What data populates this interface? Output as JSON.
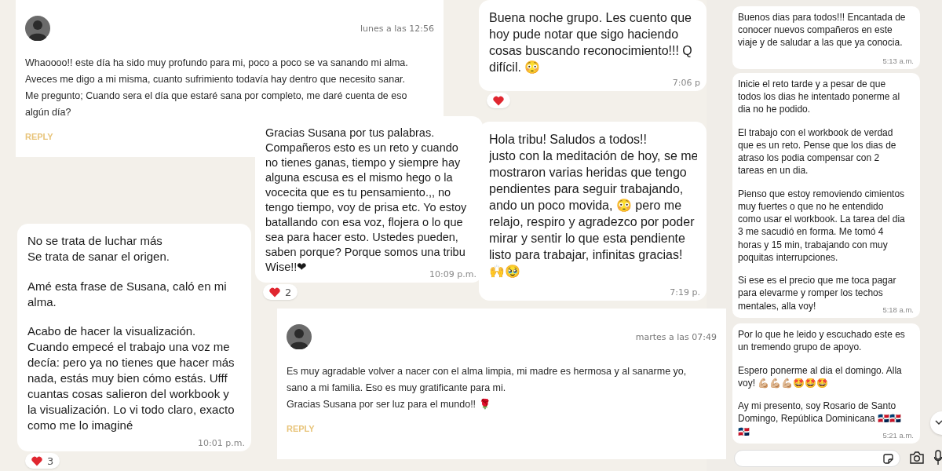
{
  "cards": [
    {
      "kind": "web_comment",
      "time": "lunes a las 12:56",
      "lines": [
        [
          "Whaoooo!! este día ha sido muy profundo para mi, poco a poco se va sanando mi alma.",
          "Aveces me digo a mi misma, cuanto sufrimiento todavía hay dentro que necesito sanar.",
          "Me pregunto; Cuando sera el día que estaré sana por completo, me daré cuenta de eso",
          "algún día?"
        ]
      ],
      "reply": "REPLY"
    },
    {
      "kind": "bubble",
      "lines": [
        [
          "No se trata de luchar más",
          "Se trata de sanar el origen."
        ],
        [
          "Amé esta frase de Susana, caló en mi",
          "alma."
        ],
        [
          "Acabo de hacer la visualización.",
          "Cuando empecé el trabajo una voz me",
          "decía: pero ya no tienes que hacer más",
          "nada, estás muy bien cómo estás. Ufff",
          "cuantas cosas salieron del workbook y",
          "la visualización. Lo vi todo claro, exacto",
          "como me lo imaginé"
        ]
      ],
      "time": "10:01 p.m.",
      "reaction": {
        "count": "3"
      }
    },
    {
      "kind": "bubble",
      "lines": [
        [
          "Gracias Susana por tus palabras.",
          "Compañeros esto es un reto y cuando",
          "no tienes ganas, tiempo y siempre hay",
          "alguna escusa es el mismo hego o la",
          "vocecita que es tu pensamiento.,, no",
          "tengo tiempo, voy de prisa etc. Yo estoy",
          "batallando con esa voz, flojera o lo que",
          "sea  para hacer esto. Ustedes pueden,",
          "saben porque? Porque somos una tribu",
          "Wise!!❤"
        ]
      ],
      "time": "10:09 p.m.",
      "reaction": {
        "count": "2"
      }
    },
    {
      "kind": "bubble",
      "lines": [
        [
          "Buena noche grupo.  Les cuento que",
          "hoy pude notar que sigo haciendo",
          "cosas buscando reconocimiento!!! Q",
          "difícil. 😳"
        ]
      ],
      "time": "7:06 p",
      "reaction": true
    },
    {
      "kind": "bubble",
      "lines": [
        [
          "Hola tribu! Saludos a todos!!",
          "justo con la meditación de hoy, se me",
          "mostraron varias heridas que tengo",
          "pendientes para seguir trabajando,",
          "ando un poco movida, 😳 pero me",
          "relajo, respiro  y agradezco por poder",
          "mirar y sentir  lo que esta pendiente",
          "listo para trabajar, infinitas gracias!",
          "🙌🥹"
        ]
      ],
      "time": "7:19 p."
    },
    {
      "kind": "web_comment",
      "time": "martes a las 07:49",
      "lines": [
        [
          "Es muy agradable volver a nacer con el alma limpia, mi madre es hermosa y al sanarme yo,",
          "sano a mi familia. Eso es muy gratificante para mi.",
          "Gracias Susana por ser luz para el mundo!! 🌹"
        ]
      ],
      "reply": "REPLY"
    }
  ],
  "side_chat": {
    "messages": [
      {
        "lines": [
          [
            "Buenos dias para todos!!! Encantada de",
            "conocer nuevos compañeros en este",
            "viaje y de saludar a las que ya conocia."
          ]
        ],
        "time": "5:13 a.m."
      },
      {
        "lines": [
          [
            "Inicie el reto tarde y a pesar de que",
            "todos los dias he intentado ponerme al",
            "dia no he podido."
          ],
          [
            "El trabajo con el workbook de verdad",
            "que es un reto. Pense que los dias de",
            "atraso los podia compensar con 2",
            "tareas en un dia."
          ],
          [
            "Pienso que estoy removiendo cimientos",
            "muy fuertes o que no he entendido",
            "como usar el workbook. La tarea del dia",
            "3 me sacudió en forma. Me tomó 4",
            "horas y 15 min, trabajando con muy",
            "poquitas interrupciones."
          ],
          [
            "Si ese es el precio que me toca pagar",
            "para elevarme y romper los techos",
            "mentales, alla voy!"
          ]
        ],
        "time": "5:18 a.m."
      },
      {
        "lines": [
          [
            "Por lo que he leido y escuchado este es",
            "un tremendo grupo de apoyo."
          ],
          [
            "Espero ponerme al dia el domingo. Alla",
            "voy! 💪🏼💪🏼💪🏼🤩🤩🤩"
          ],
          [
            "Ay mi presento, soy Rosario de Santo",
            "Domingo, República Dominicana 🇩🇴🇩🇴",
            "🇩🇴"
          ]
        ],
        "time": "5:21 a.m."
      }
    ]
  }
}
